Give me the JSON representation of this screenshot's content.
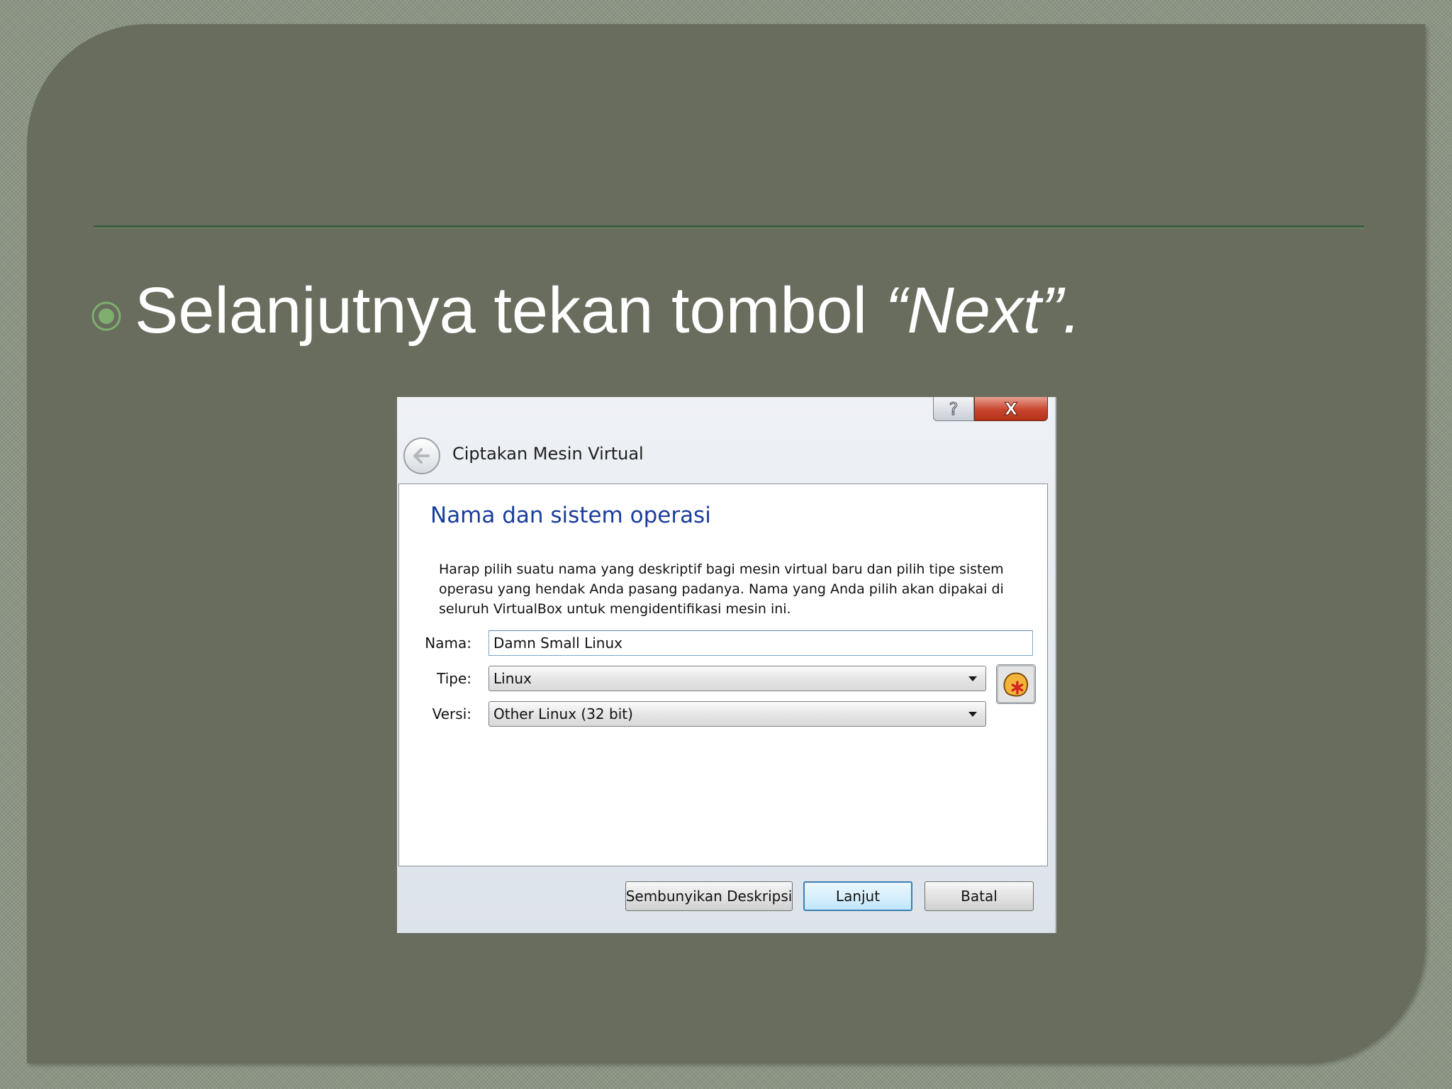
{
  "slide": {
    "bullet_text_plain": "Selanjutnya tekan tombol ",
    "bullet_text_emphasis": "“Next”."
  },
  "dialog": {
    "help_glyph": "?",
    "close_glyph": "X",
    "title": "Ciptakan Mesin Virtual",
    "section_title": "Nama dan sistem operasi",
    "description": "Harap pilih suatu nama yang deskriptif bagi mesin virtual baru dan pilih tipe sistem operasu yang hendak Anda pasang padanya. Nama yang Anda pilih akan dipakai di seluruh VirtualBox untuk mengidentifikasi mesin ini.",
    "fields": {
      "name_label": "Nama:",
      "name_value": "Damn Small Linux",
      "type_label": "Tipe:",
      "type_value": "Linux",
      "version_label": "Versi:",
      "version_value": "Other Linux (32 bit)"
    },
    "buttons": {
      "hide_description": "Sembunyikan Deskripsi",
      "next": "Lanjut",
      "cancel": "Batal"
    }
  },
  "colors": {
    "panel": "#686d5e",
    "rule": "#3c5c3e",
    "bullet": "#7fae6e",
    "section_title": "#1a3e9c",
    "close_button": "#c7452d"
  },
  "icons": {
    "bullet": "circle-bullet-icon",
    "help": "help-icon",
    "close": "close-icon",
    "back": "back-arrow-icon",
    "os": "os-type-icon",
    "dropdown": "chevron-down-icon"
  }
}
